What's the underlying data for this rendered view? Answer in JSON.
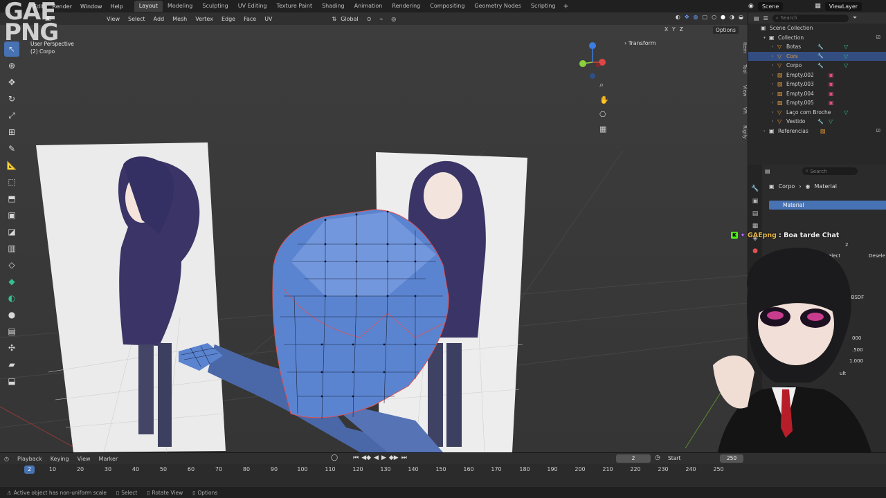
{
  "menus": [
    "Edit",
    "Render",
    "Window",
    "Help"
  ],
  "watermark": [
    "GAE",
    "PNG"
  ],
  "workspaces": [
    "Layout",
    "Modeling",
    "Sculpting",
    "UV Editing",
    "Texture Paint",
    "Shading",
    "Animation",
    "Rendering",
    "Compositing",
    "Geometry Nodes",
    "Scripting"
  ],
  "active_workspace": "Layout",
  "scene": "Scene",
  "view_layer": "ViewLayer",
  "viewport": {
    "header_menus": [
      "View",
      "Select",
      "Add",
      "Mesh",
      "Vertex",
      "Edge",
      "Face",
      "UV"
    ],
    "orientation": "Global",
    "info_line1": "User Perspective",
    "info_line2": "(2) Corpo",
    "transform_label": "Transform",
    "options_label": "Options",
    "axes": [
      "X",
      "Y",
      "Z"
    ],
    "side_tabs": [
      "Item",
      "Tool",
      "View",
      "VR",
      "Rigify"
    ]
  },
  "outliner": {
    "search_placeholder": "Search",
    "root": "Scene Collection",
    "collection": "Collection",
    "items": [
      {
        "name": "Botas"
      },
      {
        "name": "Cors"
      },
      {
        "name": "Corpo"
      },
      {
        "name": "Empty.002"
      },
      {
        "name": "Empty.003"
      },
      {
        "name": "Empty.004"
      },
      {
        "name": "Empty.005"
      },
      {
        "name": "Laço com Broche"
      },
      {
        "name": "Vestido"
      }
    ],
    "ref": "Referencias"
  },
  "properties": {
    "search_placeholder": "Search",
    "crumb_object": "Corpo",
    "crumb_material": "Material",
    "material_slot": "Material",
    "partial": [
      "2",
      "elect",
      "Desele",
      "d BSDF",
      "000",
      ".500",
      "1.000",
      "ult"
    ]
  },
  "chat": {
    "badge": "K",
    "user": "GAEpng",
    "message": ": Boa tarde Chat"
  },
  "timeline": {
    "menus": [
      "Playback",
      "Keying",
      "View",
      "Marker"
    ],
    "current_frame": "2",
    "start_label": "Start",
    "end_frame": "250",
    "ticks": [
      "10",
      "20",
      "30",
      "40",
      "50",
      "60",
      "70",
      "80",
      "90",
      "100",
      "110",
      "120",
      "130",
      "140",
      "150",
      "160",
      "170",
      "180",
      "190",
      "200",
      "210",
      "220",
      "230",
      "240",
      "250"
    ]
  },
  "statusbar": {
    "msg": "Active object has non-uniform scale",
    "select": "Select",
    "rotate": "Rotate View",
    "options": "Options"
  },
  "colors": {
    "accent": "#4772b3",
    "mesh": "#5b84d0",
    "object_orange": "#e59b3a"
  }
}
